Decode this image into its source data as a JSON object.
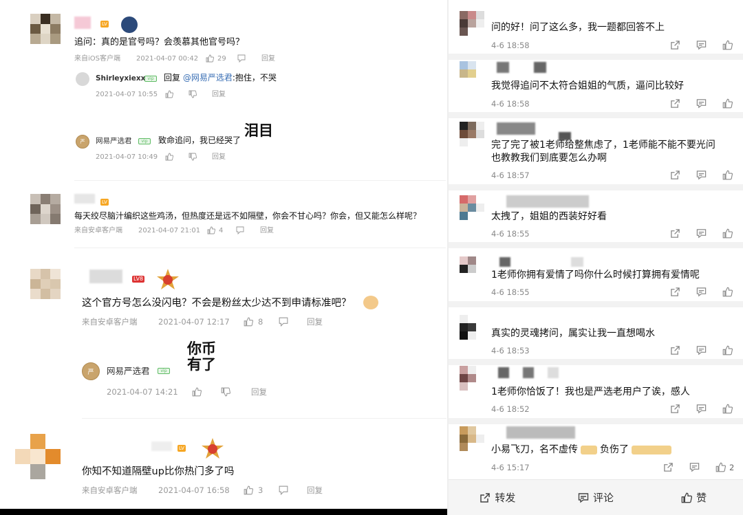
{
  "left": {
    "c1": {
      "text": "追问：真的是官号吗？会羡慕其他官号吗？",
      "source": "来自iOS客户端",
      "time": "2021-04-07 00:42",
      "likes": "29",
      "reply_label": "回复",
      "r1": {
        "name": "Shirleyxiexx",
        "reply_prefix": "回复",
        "mention": "@网易严选君",
        "reply_body": ":抱住，不哭",
        "time": "2021-04-07 10:55",
        "reply_label": "回复"
      },
      "r2": {
        "name": "网易严选君",
        "text": "致命追问，我已经哭了",
        "sticker": "泪目",
        "time": "2021-04-07 10:49",
        "reply_label": "回复"
      }
    },
    "c2": {
      "level": "LV",
      "text": "每天绞尽脑汁编织这些鸡汤，但热度还是远不如隔壁，你会不甘心吗？你会，但又能怎么样呢？",
      "source": "来自安卓客户端",
      "time": "2021-04-07 21:01",
      "likes": "4",
      "reply_label": "回复"
    },
    "c3": {
      "level": "LV8",
      "text": "这个官方号怎么没闪电？不会是粉丝太少达不到申请标准吧？",
      "source": "来自安卓客户端",
      "time": "2021-04-07 12:17",
      "likes": "8",
      "reply_label": "回复",
      "r1": {
        "name": "网易严选君",
        "sticker_top": "你币",
        "sticker_bottom": "有了",
        "time": "2021-04-07 14:21",
        "reply_label": "回复"
      }
    },
    "c4": {
      "level": "LV",
      "text": "你知不知道隔壁up比你热门多了吗",
      "source": "来自安卓客户端",
      "time": "2021-04-07 16:58",
      "likes": "3",
      "reply_label": "回复"
    }
  },
  "right": {
    "comments": [
      {
        "text": "问的好！问了这么多，我一题都回答不上",
        "time": "4-6 18:58"
      },
      {
        "text": "我觉得追问不太符合姐姐的气质，逼问比较好",
        "time": "4-6 18:58"
      },
      {
        "text": "完了完了被1老师给整焦虑了，1老师能不能不要光问",
        "text2": "也教教我们到底要怎么办啊",
        "time": "4-6 18:57"
      },
      {
        "text": "太拽了，姐姐的西装好好看",
        "time": "4-6 18:55"
      },
      {
        "text": "1老师你拥有爱情了吗你什么时候打算拥有爱情呢",
        "time": "4-6 18:55"
      },
      {
        "text": "真实的灵魂拷问，属实让我一直想喝水",
        "time": "4-6 18:53"
      },
      {
        "text": "1老师你恰饭了！我也是严选老用户了诶，感人",
        "time": "4-6 18:52"
      },
      {
        "text": "小易飞刀，名不虚传",
        "text_b": "负伤了",
        "time": "4-6 15:17",
        "likes": "2"
      }
    ],
    "footer": {
      "share": "转发",
      "comment": "评论",
      "like": "赞"
    }
  },
  "colors": {
    "accent": "#3a6fb5",
    "level_red": "#d33",
    "level_orange": "#f6a623",
    "badge_green": "#5dbb63"
  }
}
